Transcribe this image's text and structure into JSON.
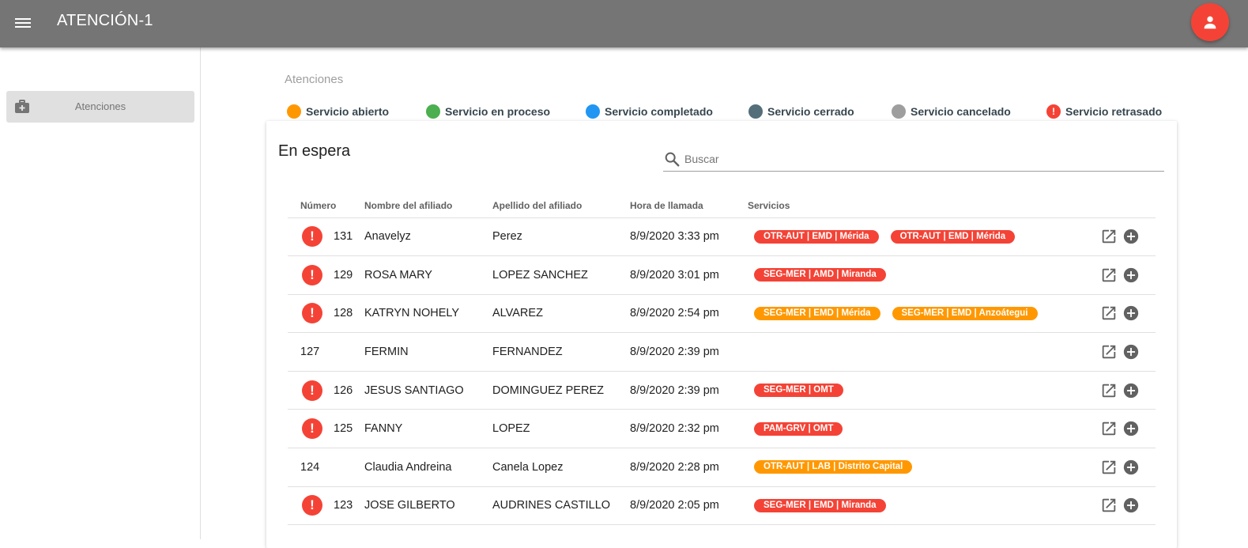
{
  "app": {
    "title": "ATENCIÓN-1"
  },
  "sidebar": {
    "items": [
      {
        "label": "Atenciones",
        "icon": "medical-kit-icon"
      }
    ]
  },
  "main": {
    "section_title": "Atenciones",
    "legend": [
      {
        "label": "Servicio abierto",
        "color": "#ff9800"
      },
      {
        "label": "Servicio en proceso",
        "color": "#4caf50"
      },
      {
        "label": "Servicio completado",
        "color": "#2196f3"
      },
      {
        "label": "Servicio cerrado",
        "color": "#546e7a"
      },
      {
        "label": "Servicio cancelado",
        "color": "#9e9e9e"
      },
      {
        "label": "Servicio retrasado",
        "color": "#f44336",
        "icon": "alert-icon"
      }
    ],
    "card": {
      "title": "En espera",
      "search_placeholder": "Buscar",
      "columns": [
        "Número",
        "Nombre del afiliado",
        "Apellido del afiliado",
        "Hora de llamada",
        "Servicios"
      ],
      "rows": [
        {
          "alert": true,
          "numero": "131",
          "nombre": "Anavelyz",
          "apellido": "Perez",
          "hora": "8/9/2020 3:33 pm",
          "servicios": [
            {
              "label": "OTR-AUT | EMD | Mérida",
              "color": "red"
            },
            {
              "label": "OTR-AUT | EMD | Mérida",
              "color": "red"
            }
          ]
        },
        {
          "alert": true,
          "numero": "129",
          "nombre": "ROSA MARY",
          "apellido": "LOPEZ SANCHEZ",
          "hora": "8/9/2020 3:01 pm",
          "servicios": [
            {
              "label": "SEG-MER | AMD | Miranda",
              "color": "red"
            }
          ]
        },
        {
          "alert": true,
          "numero": "128",
          "nombre": "KATRYN NOHELY",
          "apellido": "ALVAREZ",
          "hora": "8/9/2020 2:54 pm",
          "servicios": [
            {
              "label": "SEG-MER | EMD | Mérida",
              "color": "orange"
            },
            {
              "label": "SEG-MER | EMD | Anzoátegui",
              "color": "orange"
            }
          ]
        },
        {
          "alert": false,
          "numero": "127",
          "nombre": "FERMIN",
          "apellido": "FERNANDEZ",
          "hora": "8/9/2020 2:39 pm",
          "servicios": []
        },
        {
          "alert": true,
          "numero": "126",
          "nombre": "JESUS SANTIAGO",
          "apellido": "DOMINGUEZ PEREZ",
          "hora": "8/9/2020 2:39 pm",
          "servicios": [
            {
              "label": "SEG-MER | OMT",
              "color": "red"
            }
          ]
        },
        {
          "alert": true,
          "numero": "125",
          "nombre": "FANNY",
          "apellido": "LOPEZ",
          "hora": "8/9/2020 2:32 pm",
          "servicios": [
            {
              "label": "PAM-GRV | OMT",
              "color": "red"
            }
          ]
        },
        {
          "alert": false,
          "numero": "124",
          "nombre": "Claudia Andreina",
          "apellido": "Canela Lopez",
          "hora": "8/9/2020 2:28 pm",
          "servicios": [
            {
              "label": "OTR-AUT | LAB | Distrito Capital",
              "color": "orange"
            }
          ]
        },
        {
          "alert": true,
          "numero": "123",
          "nombre": "JOSE GILBERTO",
          "apellido": "AUDRINES CASTILLO",
          "hora": "8/9/2020 2:05 pm",
          "servicios": [
            {
              "label": "SEG-MER | EMD | Miranda",
              "color": "red"
            }
          ]
        }
      ],
      "row_actions": [
        "open-in-new-icon",
        "add-circle-icon"
      ]
    }
  }
}
